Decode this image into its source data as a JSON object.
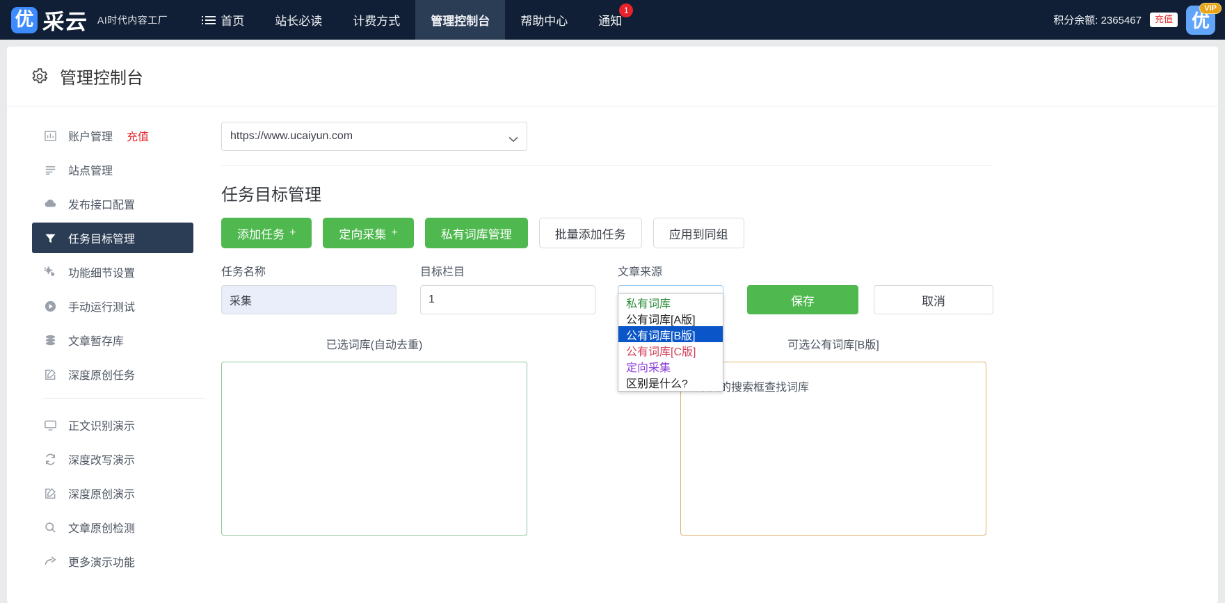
{
  "topbar": {
    "logo_mark": "优",
    "logo_word": "采云",
    "logo_tagline": "AI时代内容工厂",
    "nav": [
      {
        "label": "首页",
        "icon": "list-icon",
        "active": false,
        "badge": ""
      },
      {
        "label": "站长必读",
        "icon": "",
        "active": false,
        "badge": ""
      },
      {
        "label": "计费方式",
        "icon": "",
        "active": false,
        "badge": ""
      },
      {
        "label": "管理控制台",
        "icon": "",
        "active": true,
        "badge": ""
      },
      {
        "label": "帮助中心",
        "icon": "",
        "active": false,
        "badge": ""
      },
      {
        "label": "通知",
        "icon": "",
        "active": false,
        "badge": "1"
      }
    ],
    "credit_label": "积分余额: 2365467",
    "credit_button": "充值",
    "avatar_letter": "优",
    "vip_label": "VIP",
    "colors": {
      "bar_bg": "#101f35",
      "active_bg": "#2b3c55",
      "badge_red": "#e8232b"
    }
  },
  "page": {
    "title": "管理控制台",
    "gear_icon": "gear-icon"
  },
  "sidebar": {
    "items": [
      {
        "label": "账户管理",
        "suffix": "充值",
        "icon": "chart-bar-icon",
        "active": false
      },
      {
        "label": "站点管理",
        "suffix": "",
        "icon": "list-lines-icon",
        "active": false
      },
      {
        "label": "发布接口配置",
        "suffix": "",
        "icon": "cloud-upload-icon",
        "active": false
      },
      {
        "label": "任务目标管理",
        "suffix": "",
        "icon": "filter-funnel-icon",
        "active": true
      },
      {
        "label": "功能细节设置",
        "suffix": "",
        "icon": "cogs-icon",
        "active": false
      },
      {
        "label": "手动运行测试",
        "suffix": "",
        "icon": "play-circle-icon",
        "active": false
      },
      {
        "label": "文章暂存库",
        "suffix": "",
        "icon": "database-icon",
        "active": false
      },
      {
        "label": "深度原创任务",
        "suffix": "",
        "icon": "edit-square-icon",
        "active": false
      }
    ],
    "items2": [
      {
        "label": "正文识别演示",
        "suffix": "",
        "icon": "desktop-icon",
        "active": false
      },
      {
        "label": "深度改写演示",
        "suffix": "",
        "icon": "refresh-icon",
        "active": false
      },
      {
        "label": "深度原创演示",
        "suffix": "",
        "icon": "edit-square-icon",
        "active": false
      },
      {
        "label": "文章原创检测",
        "suffix": "",
        "icon": "search-icon",
        "active": false
      },
      {
        "label": "更多演示功能",
        "suffix": "",
        "icon": "arrow-share-icon",
        "active": false
      }
    ]
  },
  "main": {
    "site_select_value": "https://www.ucaiyun.com",
    "section_title": "任务目标管理",
    "buttons": [
      {
        "label": "添加任务",
        "plus": "+",
        "style": "green"
      },
      {
        "label": "定向采集",
        "plus": "+",
        "style": "green"
      },
      {
        "label": "私有词库管理",
        "plus": "",
        "style": "green"
      },
      {
        "label": "批量添加任务",
        "plus": "",
        "style": "white"
      },
      {
        "label": "应用到同组",
        "plus": "",
        "style": "white"
      }
    ],
    "form": {
      "task_name_label": "任务名称",
      "task_name_value": "采集",
      "target_column_label": "目标栏目",
      "target_column_value": "1",
      "source_label": "文章来源",
      "source_value": "公有词库[B版]",
      "save_label": "保存",
      "cancel_label": "取消"
    },
    "dropdown": {
      "open": true,
      "options": [
        {
          "label": "私有词库",
          "color": "#2f8f3e",
          "selected": false
        },
        {
          "label": "公有词库[A版]",
          "color": "#1b1b1b",
          "selected": false
        },
        {
          "label": "公有词库[B版]",
          "color": "#ffffff",
          "selected": true
        },
        {
          "label": "公有词库[C版]",
          "color": "#d2425a",
          "selected": false
        },
        {
          "label": "定向采集",
          "color": "#8b3fd6",
          "selected": false
        },
        {
          "label": "区别是什么?",
          "color": "#1b1b1b",
          "selected": false
        }
      ],
      "highlight_color": "#0a56c8"
    },
    "panels": {
      "left_title": "已选词库(自动去重)",
      "right_title": "可选公有词库[B版]",
      "right_hint": "下面的搜索框查找词库"
    }
  }
}
